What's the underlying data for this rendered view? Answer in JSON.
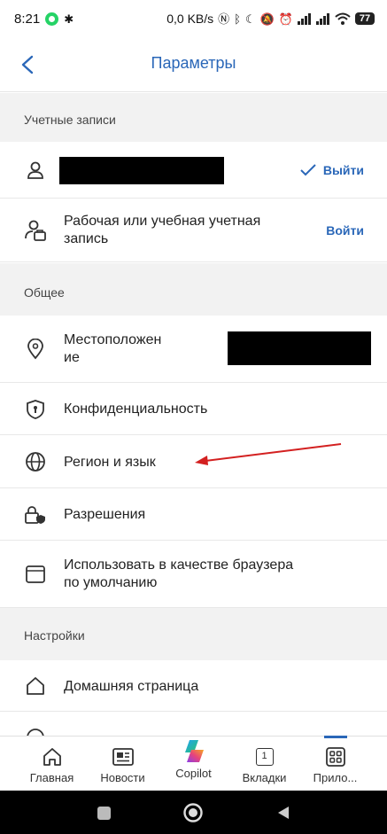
{
  "statusbar": {
    "time": "8:21",
    "network_speed": "0,0 KB/s",
    "battery": "77"
  },
  "header": {
    "title": "Параметры",
    "back_icon": "chevron-left-icon"
  },
  "sections": {
    "accounts": {
      "title": "Учетные записи",
      "signin_label": "Выйти",
      "work_account_label": "Рабочая или учебная учетная запись",
      "work_signin_label": "Войти"
    },
    "general": {
      "title": "Общее",
      "items": [
        {
          "label_line1": "Местоположен",
          "label_line2": "ие",
          "icon": "location-pin-icon"
        },
        {
          "label": "Конфиденциальность",
          "icon": "shield-icon"
        },
        {
          "label": "Регион и язык",
          "icon": "globe-icon"
        },
        {
          "label": "Разрешения",
          "icon": "lock-shield-icon"
        },
        {
          "label_line1": "Использовать в качестве браузера",
          "label_line2": "по умолчанию",
          "icon": "browser-icon"
        }
      ]
    },
    "settings": {
      "title": "Настройки",
      "items": [
        {
          "label": "Домашняя страница",
          "icon": "home-icon"
        }
      ]
    }
  },
  "bottom_nav": {
    "items": [
      {
        "label": "Главная",
        "icon": "home-icon"
      },
      {
        "label": "Новости",
        "icon": "news-icon"
      },
      {
        "label": "Copilot",
        "icon": "copilot-icon"
      },
      {
        "label": "Вкладки",
        "icon": "tabs-icon",
        "badge": "1"
      },
      {
        "label": "Прило...",
        "icon": "apps-icon"
      }
    ]
  },
  "colors": {
    "accent": "#2a67b8",
    "section_bg": "#f2f2f2",
    "annotation_arrow": "#d32020"
  }
}
